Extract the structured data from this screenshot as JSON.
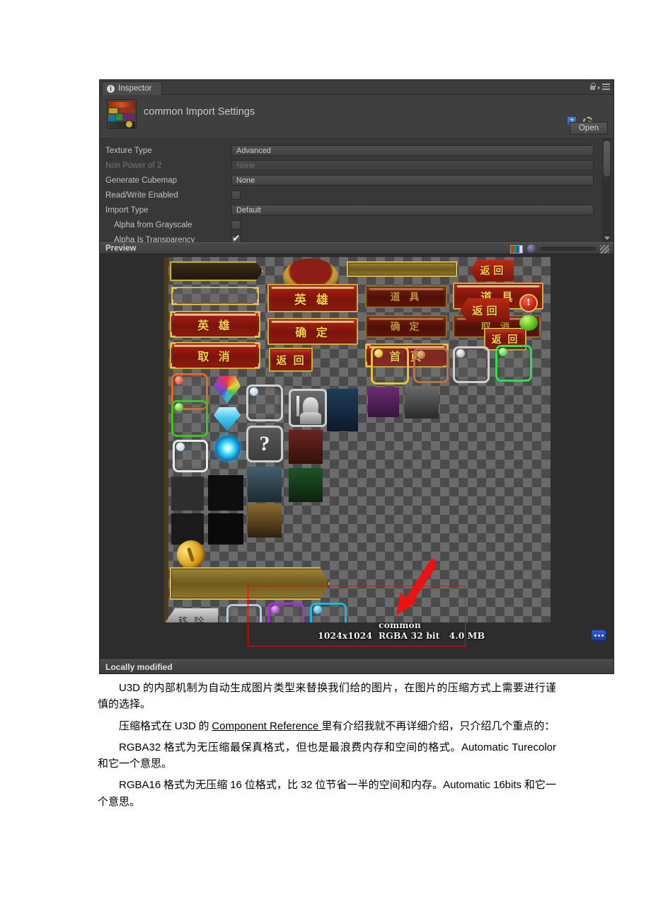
{
  "inspector": {
    "tab": {
      "label": "Inspector",
      "icon": "info-icon"
    },
    "asset": {
      "title": "common Import Settings",
      "open_button": "Open",
      "icons": [
        "lock-icon",
        "menu-icon",
        "book-icon",
        "gear-icon"
      ]
    },
    "properties": [
      {
        "label": "Texture Type",
        "type": "dropdown",
        "value": "Advanced",
        "disabled": false,
        "indent": false
      },
      {
        "label": "Non Power of 2",
        "type": "dropdown",
        "value": "None",
        "disabled": true,
        "indent": false
      },
      {
        "label": "Generate Cubemap",
        "type": "dropdown",
        "value": "None",
        "disabled": false,
        "indent": false
      },
      {
        "label": "Read/Write Enabled",
        "type": "checkbox",
        "value": "",
        "checked": false,
        "indent": false
      },
      {
        "label": "Import Type",
        "type": "dropdown",
        "value": "Default",
        "disabled": false,
        "indent": false
      },
      {
        "label": "Alpha from Grayscale",
        "type": "checkbox",
        "value": "",
        "checked": false,
        "indent": true
      },
      {
        "label": "Alpha Is Transparency",
        "type": "checkbox",
        "value": "",
        "checked": true,
        "indent": true
      }
    ],
    "preview": {
      "title": "Preview",
      "tools": [
        "rgba-swatch-icon",
        "sphere-icon",
        "mip-slider",
        "checker-icon"
      ],
      "texture_info": {
        "name": "common",
        "dimensions": "1024x1024",
        "format": "RGBA 32 bit",
        "size": "4.0 MB"
      },
      "sprites": {
        "hero": "英 雄",
        "cancel": "取 消",
        "confirm": "确 定",
        "back": "返 回",
        "item": "道 具",
        "home": "首 页",
        "remove": "移 除",
        "question": "?",
        "alert": "!"
      }
    },
    "statusbar": {
      "text": "Locally modified"
    },
    "dots_button": "..."
  },
  "annotation": {
    "accent_color": "#e01010",
    "shape": "arrow-and-rectangle"
  },
  "document": {
    "paragraphs": [
      {
        "id": "p1",
        "runs": [
          {
            "t": "U3D",
            "style": "lat"
          },
          {
            "t": " 的内部机制为自动生成图片类型来替换我们给的图片，在图片的压缩方式上需要进行谨慎的选择。",
            "style": "cn"
          }
        ]
      },
      {
        "id": "p2",
        "runs": [
          {
            "t": "压缩格式在 ",
            "style": "cn"
          },
          {
            "t": "U3D",
            "style": "lat"
          },
          {
            "t": " 的 ",
            "style": "cn"
          },
          {
            "t": "Component Reference ",
            "style": "link"
          },
          {
            "t": "里有介绍我就不再详细介绍，只介绍几个重点的：",
            "style": "cn"
          }
        ]
      },
      {
        "id": "p3",
        "runs": [
          {
            "t": "RGBA32",
            "style": "lat"
          },
          {
            "t": " 格式为无压缩最保真格式，但也是最浪费内存和空间的格式。",
            "style": "cn"
          },
          {
            "t": "Automatic Turecolor",
            "style": "lat"
          },
          {
            "t": " 和它一个意思。",
            "style": "cn"
          }
        ]
      },
      {
        "id": "p4",
        "runs": [
          {
            "t": "RGBA16",
            "style": "lat"
          },
          {
            "t": " 格式为无压缩 ",
            "style": "cn"
          },
          {
            "t": "16",
            "style": "lat"
          },
          {
            "t": " 位格式，比 ",
            "style": "cn"
          },
          {
            "t": "32",
            "style": "lat"
          },
          {
            "t": " 位节省一半的空间和内存。",
            "style": "cn"
          },
          {
            "t": "Automatic 16bits",
            "style": "lat"
          },
          {
            "t": " 和它一个意思。",
            "style": "cn"
          }
        ]
      }
    ]
  }
}
